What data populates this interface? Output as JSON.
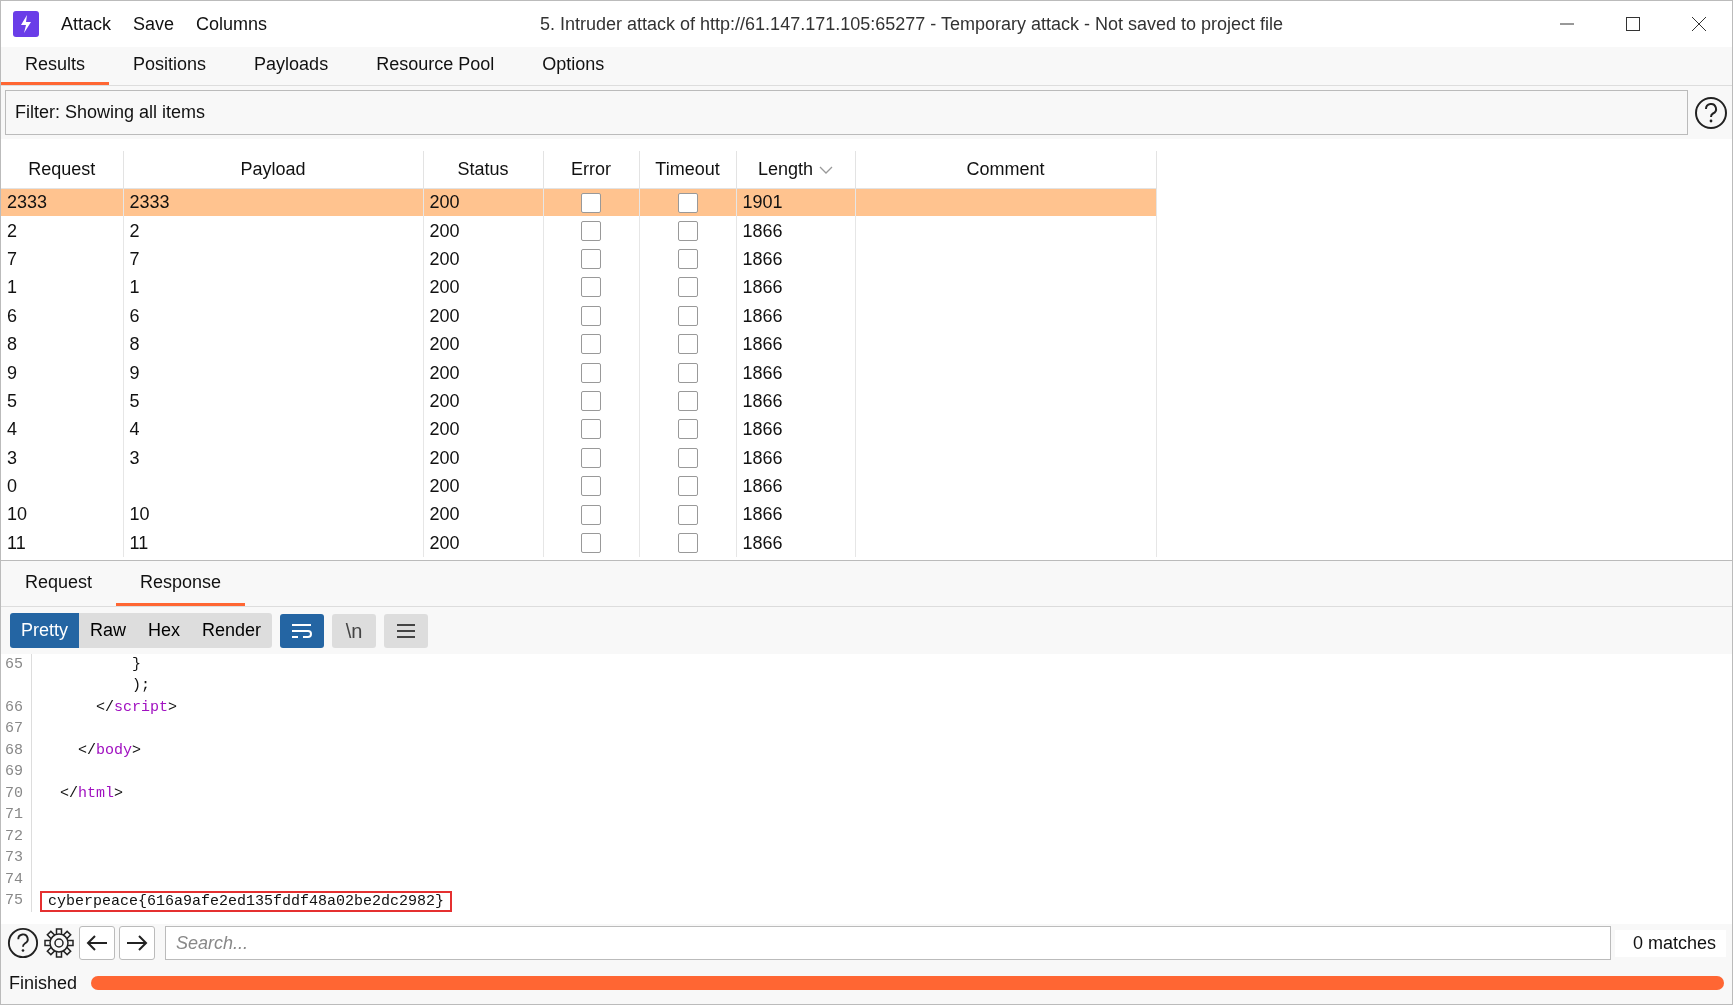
{
  "window": {
    "title": "5. Intruder attack of http://61.147.171.105:65277 - Temporary attack - Not saved to project file"
  },
  "menu": [
    "Attack",
    "Save",
    "Columns"
  ],
  "tabs": [
    {
      "label": "Results",
      "selected": true
    },
    {
      "label": "Positions",
      "selected": false
    },
    {
      "label": "Payloads",
      "selected": false
    },
    {
      "label": "Resource Pool",
      "selected": false
    },
    {
      "label": "Options",
      "selected": false
    }
  ],
  "filter": {
    "text": "Filter: Showing all items"
  },
  "table": {
    "columns": [
      {
        "label": "Request",
        "sorted": false
      },
      {
        "label": "Payload",
        "sorted": false
      },
      {
        "label": "Status",
        "sorted": false
      },
      {
        "label": "Error",
        "sorted": false
      },
      {
        "label": "Timeout",
        "sorted": false
      },
      {
        "label": "Length",
        "sorted": true
      },
      {
        "label": "Comment",
        "sorted": false
      }
    ],
    "rows": [
      {
        "request": "2333",
        "payload": "2333",
        "status": "200",
        "error": false,
        "timeout": false,
        "length": "1901",
        "selected": true
      },
      {
        "request": "2",
        "payload": "2",
        "status": "200",
        "error": false,
        "timeout": false,
        "length": "1866",
        "selected": false
      },
      {
        "request": "7",
        "payload": "7",
        "status": "200",
        "error": false,
        "timeout": false,
        "length": "1866",
        "selected": false
      },
      {
        "request": "1",
        "payload": "1",
        "status": "200",
        "error": false,
        "timeout": false,
        "length": "1866",
        "selected": false
      },
      {
        "request": "6",
        "payload": "6",
        "status": "200",
        "error": false,
        "timeout": false,
        "length": "1866",
        "selected": false
      },
      {
        "request": "8",
        "payload": "8",
        "status": "200",
        "error": false,
        "timeout": false,
        "length": "1866",
        "selected": false
      },
      {
        "request": "9",
        "payload": "9",
        "status": "200",
        "error": false,
        "timeout": false,
        "length": "1866",
        "selected": false
      },
      {
        "request": "5",
        "payload": "5",
        "status": "200",
        "error": false,
        "timeout": false,
        "length": "1866",
        "selected": false
      },
      {
        "request": "4",
        "payload": "4",
        "status": "200",
        "error": false,
        "timeout": false,
        "length": "1866",
        "selected": false
      },
      {
        "request": "3",
        "payload": "3",
        "status": "200",
        "error": false,
        "timeout": false,
        "length": "1866",
        "selected": false
      },
      {
        "request": "0",
        "payload": "",
        "status": "200",
        "error": false,
        "timeout": false,
        "length": "1866",
        "selected": false
      },
      {
        "request": "10",
        "payload": "10",
        "status": "200",
        "error": false,
        "timeout": false,
        "length": "1866",
        "selected": false
      },
      {
        "request": "11",
        "payload": "11",
        "status": "200",
        "error": false,
        "timeout": false,
        "length": "1866",
        "selected": false
      }
    ]
  },
  "message_tabs": [
    {
      "label": "Request",
      "selected": false
    },
    {
      "label": "Response",
      "selected": true
    }
  ],
  "view_modes": [
    {
      "label": "Pretty",
      "selected": true
    },
    {
      "label": "Raw",
      "selected": false
    },
    {
      "label": "Hex",
      "selected": false
    },
    {
      "label": "Render",
      "selected": false
    }
  ],
  "tool_buttons": [
    {
      "kind": "wrap",
      "selected": true
    },
    {
      "kind": "newline",
      "label": "\\n",
      "selected": false
    },
    {
      "kind": "menu",
      "selected": false
    }
  ],
  "code": [
    {
      "number": "65",
      "highlighted": false,
      "parts": [
        {
          "kind": "text",
          "text": "          }"
        }
      ]
    },
    {
      "highlighted": false,
      "parts": [
        {
          "kind": "text",
          "text": "          );"
        }
      ]
    },
    {
      "number": "66",
      "highlighted": false,
      "parts": [
        {
          "kind": "text",
          "text": "      </"
        },
        {
          "kind": "tag",
          "text": "script"
        },
        {
          "kind": "text",
          "text": ">"
        }
      ]
    },
    {
      "number": "67"
    },
    {
      "number": "68",
      "highlighted": false,
      "parts": [
        {
          "kind": "text",
          "text": "    </"
        },
        {
          "kind": "tag",
          "text": "body"
        },
        {
          "kind": "text",
          "text": ">"
        }
      ]
    },
    {
      "number": "69"
    },
    {
      "number": "70",
      "highlighted": false,
      "parts": [
        {
          "kind": "text",
          "text": "  </"
        },
        {
          "kind": "tag",
          "text": "html"
        },
        {
          "kind": "text",
          "text": ">"
        }
      ]
    },
    {
      "number": "71"
    },
    {
      "number": "72"
    },
    {
      "number": "73"
    },
    {
      "number": "74"
    },
    {
      "number": "75",
      "highlighted": true,
      "parts": [
        {
          "kind": "text",
          "text": "cyberpeace{616a9afe2ed135fddf48a02be2dc2982}"
        }
      ]
    }
  ],
  "search": {
    "placeholder": "Search...",
    "matches": "0 matches"
  },
  "status_bar": {
    "text": "Finished",
    "level": 1
  }
}
